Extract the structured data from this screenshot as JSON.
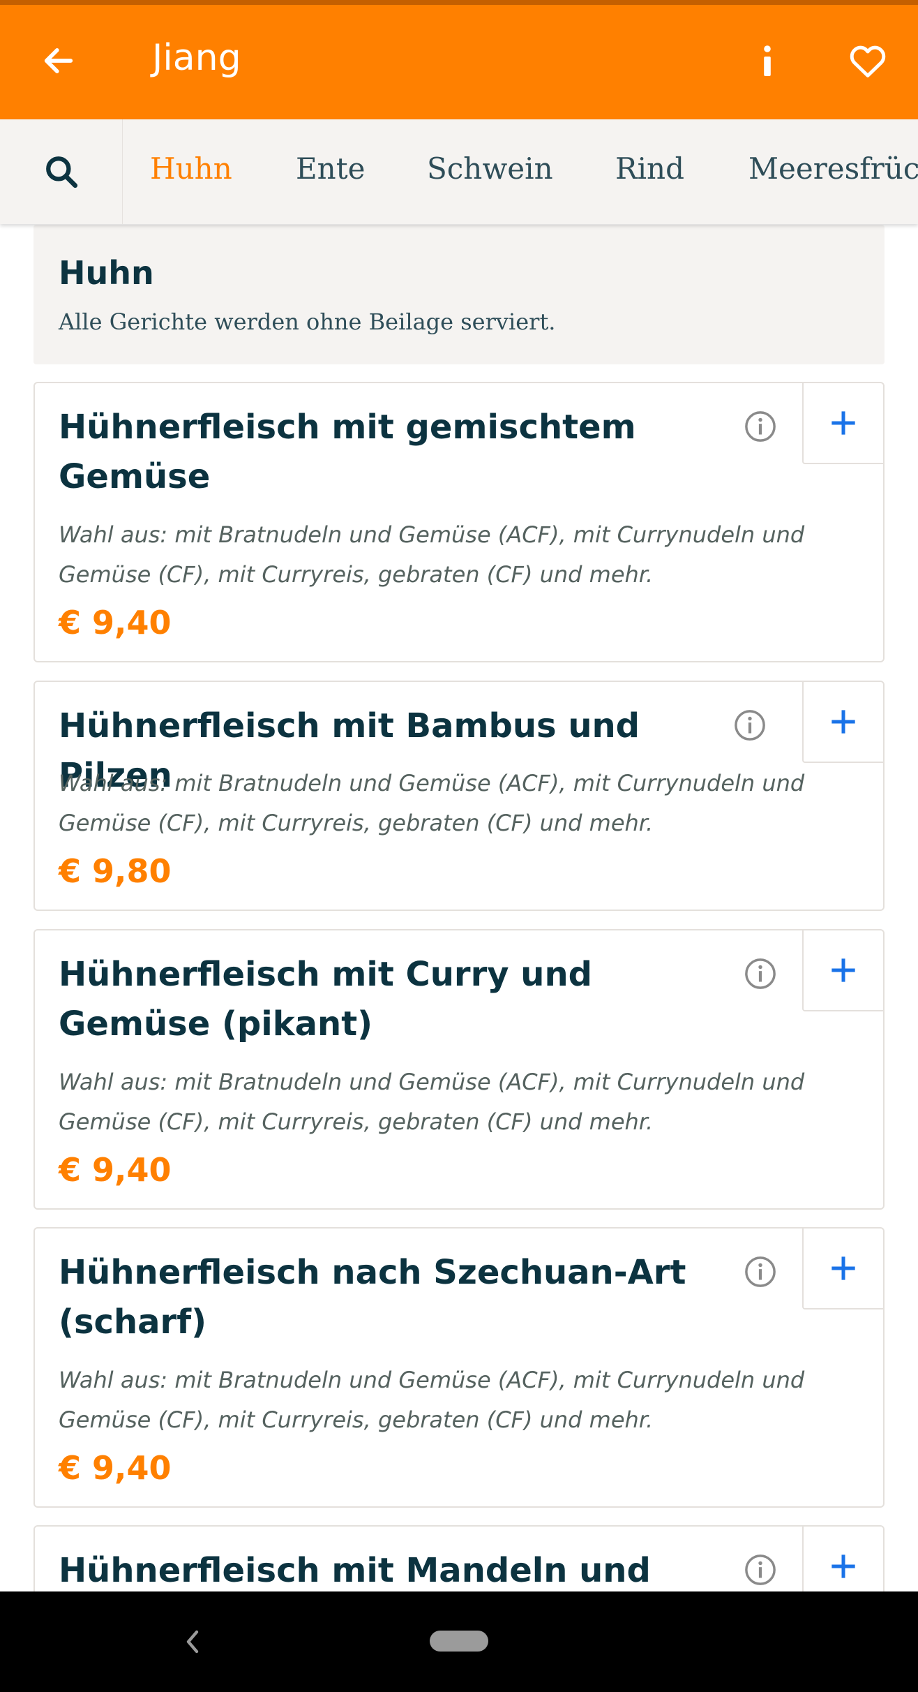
{
  "header": {
    "title": "Jiang",
    "back_icon": "arrow-left-icon",
    "info_icon": "info-icon",
    "favorite_icon": "heart-outline-icon",
    "background_color": "#ff8000"
  },
  "categories": {
    "search_icon": "search-icon",
    "tabs": [
      {
        "label": "Huhn",
        "active": true
      },
      {
        "label": "Ente",
        "active": false
      },
      {
        "label": "Schwein",
        "active": false
      },
      {
        "label": "Rind",
        "active": false
      },
      {
        "label": "Meeresfrüch",
        "active": false
      }
    ]
  },
  "section": {
    "title": "Huhn",
    "subtitle": "Alle Gerichte werden ohne Beilage serviert."
  },
  "dishes": [
    {
      "name": "Hühnerfleisch mit gemischtem Gemüse",
      "description": "Wahl aus: mit Bratnudeln und Gemüse (ACF), mit Currynudeln und Gemüse (CF), mit Curryreis, gebraten (CF) und mehr.",
      "price": "€ 9,40"
    },
    {
      "name": "Hühnerfleisch mit Bambus und Pilzen",
      "description": "Wahl aus: mit Bratnudeln und Gemüse (ACF), mit Currynudeln und Gemüse (CF), mit Curryreis, gebraten (CF) und mehr.",
      "price": "€ 9,80"
    },
    {
      "name": "Hühnerfleisch mit Curry und Gemüse (pikant)",
      "description": "Wahl aus: mit Bratnudeln und Gemüse (ACF), mit Currynudeln und Gemüse (CF), mit Curryreis, gebraten (CF) und mehr.",
      "price": "€ 9,40"
    },
    {
      "name": "Hühnerfleisch nach Szechuan-Art (scharf)",
      "description": "Wahl aus: mit Bratnudeln und Gemüse (ACF), mit Currynudeln und Gemüse (CF), mit Curryreis, gebraten (CF) und mehr.",
      "price": "€ 9,40"
    },
    {
      "name": "Hühnerfleisch mit Mandeln und",
      "description": "",
      "price": ""
    }
  ],
  "colors": {
    "accent": "#ff8000",
    "text_dark": "#0c3340",
    "add_button": "#1a73e8"
  },
  "nav": {
    "back_icon": "chevron-left-icon",
    "home_icon": "home-pill-icon"
  }
}
